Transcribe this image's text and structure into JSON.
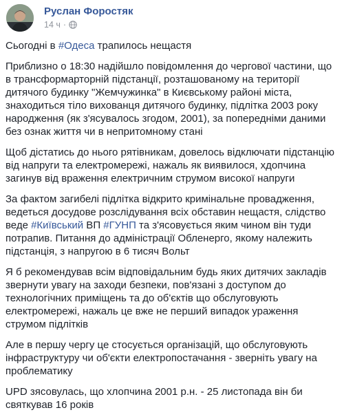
{
  "post": {
    "author": "Руслан Форостяк",
    "time": "14 ч",
    "privacy_icon": "globe-icon",
    "paragraphs": [
      [
        {
          "text": "Сьогодні в "
        },
        {
          "text": "#Одеса",
          "tag": true
        },
        {
          "text": " трапилось нещастя"
        }
      ],
      [
        {
          "text": "Приблизно о 18:30 надійшло повідомлення до чергової частини, що в трансформарторній підстанції, розташованому на території дитячого будинку \"Жемчужинка\" в Києвському районі міста, знаходиться тіло вихованця дитячого будинку, підлітка 2003 року народження (як з'ясувалось згодом, 2001), за попередніми даними без ознак життя чи в непритомному стані"
        }
      ],
      [
        {
          "text": "Щоб дістатись до нього рятівникам, довелось відключати підстанцію від напруги та електромережі, нажаль як виявилося, хдопчина загинув від враження електричним струмом високої напруги"
        }
      ],
      [
        {
          "text": "За фактом загибелі підлітка відкрито кримінальне провадження, ведеться досудове розслідування всіх обставин нещастя, слідство веде "
        },
        {
          "text": "#Київський",
          "tag": true
        },
        {
          "text": " ВП "
        },
        {
          "text": "#ГУНП",
          "tag": true
        },
        {
          "text": " та з'ясовується яким чином він туди потрапив. Питання до адміністрації Обленерго, якому належить підстанція, з напругою в 6 тисяч Вольт"
        }
      ],
      [
        {
          "text": "Я б рекомендував всім відповідальним будь яких дитячих закладів звернути увагу на заходи безпеки, пов'язані з доступом до технологічних приміщень та до об'єктів що обслуговують електромережі, нажаль це вже не перший випадок ураження струмом підлітків"
        }
      ],
      [
        {
          "text": "Але в першу чергу це стосується організацій, що обслуговують інфраструктуру чи об'єкти електропостачання - зверніть увагу на проблематику"
        }
      ],
      [
        {
          "text": "UPD зясовулась, що хлопчина 2001 р.н. - 25 листопада він би святкував 16 років"
        }
      ]
    ]
  },
  "colors": {
    "link": "#365899",
    "text": "#1d2129",
    "meta": "#90949c"
  }
}
